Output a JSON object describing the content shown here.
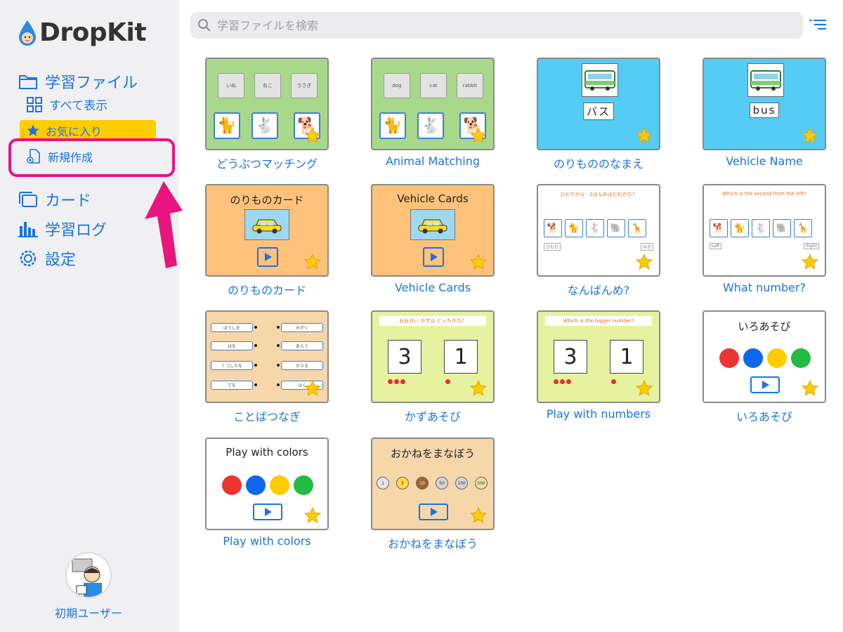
{
  "app": {
    "logo_text": "DropKit"
  },
  "sidebar": {
    "learning_files": "学習ファイル",
    "show_all": "すべて表示",
    "favorites": "お気に入り",
    "new_create": "新規作成",
    "cards": "カード",
    "learning_log": "学習ログ",
    "settings": "設定",
    "user_name": "初期ユーザー"
  },
  "search": {
    "placeholder": "学習ファイルを検索"
  },
  "colors": {
    "accent": "#1a73e8",
    "highlight": "#e8157e",
    "favorite": "#ffcc00"
  },
  "cards": [
    {
      "title": "どうぶつマッチング",
      "words": [
        "いぬ",
        "ねこ",
        "うさぎ"
      ]
    },
    {
      "title": "Animal Matching",
      "words": [
        "dog",
        "cat",
        "rabbit"
      ]
    },
    {
      "title": "のりもののなまえ",
      "caption": "バス"
    },
    {
      "title": "Vehicle Name",
      "caption": "bus"
    },
    {
      "title": "のりものカード",
      "inner_title": "のりものカード"
    },
    {
      "title": "Vehicle Cards",
      "inner_title": "Vehicle Cards"
    },
    {
      "title": "なんばんめ?",
      "question": "ひだりから　2ばんめはどれかな？",
      "left": "ひだり",
      "right": "みぎ"
    },
    {
      "title": "What number?",
      "question": "Which is the second from the left?",
      "left": "Left",
      "right": "Right"
    },
    {
      "title": "ことばつなぎ",
      "left_words": [
        "ぼうしを",
        "はを",
        "くつしたを",
        "てを"
      ],
      "right_words": [
        "みがく",
        "あらう",
        "かぶる",
        "はく"
      ]
    },
    {
      "title": "かずあそび",
      "question": "おおきい かずは どっちかな？",
      "numbers": [
        "3",
        "1"
      ]
    },
    {
      "title": "Play with numbers",
      "question": "Which is the bigger number?",
      "numbers": [
        "3",
        "1"
      ]
    },
    {
      "title": "いろあそび",
      "inner_title": "いろあそび"
    },
    {
      "title": "Play with colors",
      "inner_title": "Play with colors"
    },
    {
      "title": "おかねをまなぼう",
      "inner_title": "おかねをまなぼう",
      "coins": [
        "1",
        "5",
        "10",
        "50",
        "100",
        "500"
      ]
    }
  ]
}
